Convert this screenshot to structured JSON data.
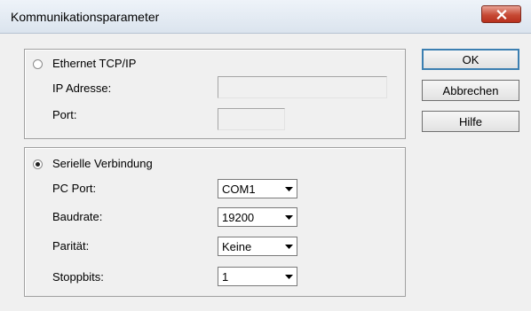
{
  "window": {
    "title": "Kommunikationsparameter"
  },
  "ethernet": {
    "label": "Ethernet TCP/IP",
    "selected": false,
    "ip_label": "IP Adresse:",
    "ip_value": "",
    "port_label": "Port:",
    "port_value": ""
  },
  "serial": {
    "label": "Serielle Verbindung",
    "selected": true,
    "pc_port": {
      "label": "PC Port:",
      "value": "COM1"
    },
    "baudrate": {
      "label": "Baudrate:",
      "value": "19200"
    },
    "parity": {
      "label": "Parität:",
      "value": "Keine"
    },
    "stopbits": {
      "label": "Stoppbits:",
      "value": "1"
    }
  },
  "buttons": {
    "ok": "OK",
    "cancel": "Abbrechen",
    "help": "Hilfe"
  },
  "icons": {
    "close": "close-icon",
    "dropdown": "chevron-down-icon"
  },
  "colors": {
    "close_button": "#c64a35",
    "default_button_border": "#3c7fb1",
    "dialog_background": "#f0f0f0"
  }
}
